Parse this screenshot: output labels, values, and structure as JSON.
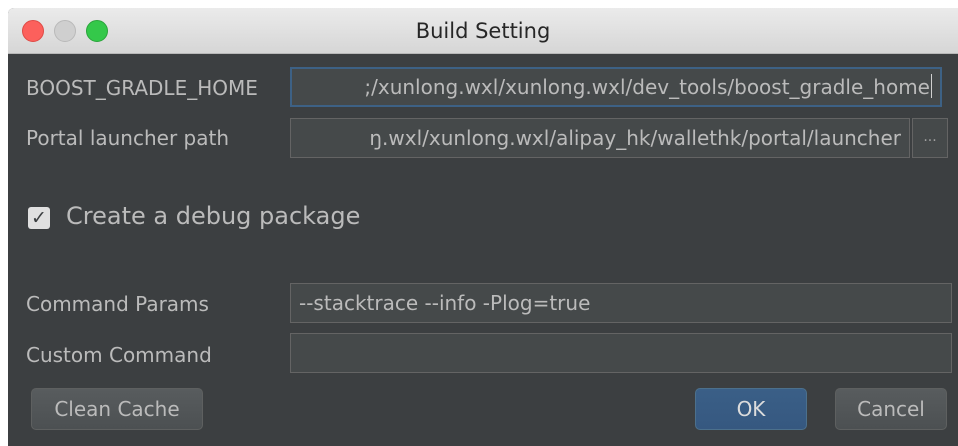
{
  "window": {
    "title": "Build Setting"
  },
  "form": {
    "boost_gradle_home": {
      "label": "BOOST_GRADLE_HOME",
      "value": ";/xunlong.wxl/xunlong.wxl/dev_tools/boost_gradle_home"
    },
    "portal_launcher_path": {
      "label": "Portal launcher path",
      "value": "ŋ.wxl/xunlong.wxl/alipay_hk/wallethk/portal/launcher",
      "browse_label": "..."
    },
    "debug_package": {
      "label": "Create a debug package",
      "checked": true,
      "check_glyph": "✓"
    },
    "command_params": {
      "label": "Command Params",
      "value": "--stacktrace --info -Plog=true"
    },
    "custom_command": {
      "label": "Custom Command",
      "value": ""
    }
  },
  "buttons": {
    "clean_cache": "Clean Cache",
    "ok": "OK",
    "cancel": "Cancel"
  },
  "colors": {
    "background": "#3c3f41",
    "field": "#45494a",
    "text": "#bbbbbb",
    "focus": "#3d6185",
    "primary_button": "#365880"
  }
}
